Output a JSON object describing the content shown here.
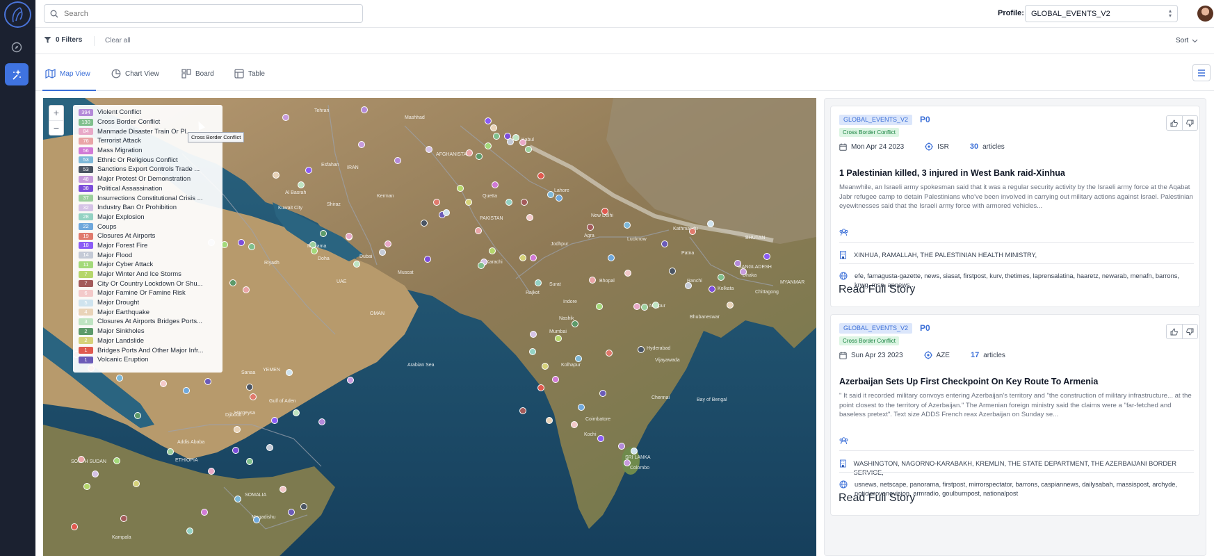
{
  "search": {
    "placeholder": "Search"
  },
  "profile": {
    "label": "Profile:",
    "value": "GLOBAL_EVENTS_V2"
  },
  "filterbar": {
    "filters_label": "0 Filters",
    "clear_label": "Clear all",
    "sort_label": "Sort"
  },
  "tabs": [
    {
      "label": "Map View",
      "active": true
    },
    {
      "label": "Chart View",
      "active": false
    },
    {
      "label": "Board",
      "active": false
    },
    {
      "label": "Table",
      "active": false
    }
  ],
  "legend": [
    {
      "count": "394",
      "label": "Violent Conflict",
      "color": "#b48ad9"
    },
    {
      "count": "130",
      "label": "Cross Border Conflict",
      "color": "#7fbf8c"
    },
    {
      "count": "84",
      "label": "Manmade Disaster Train Or Pl...",
      "color": "#e8a9c7"
    },
    {
      "count": "76",
      "label": "Terrorist Attack",
      "color": "#e9a4a6"
    },
    {
      "count": "56",
      "label": "Mass Migration",
      "color": "#d17ad6"
    },
    {
      "count": "53",
      "label": "Ethnic Or Religious Conflict",
      "color": "#7db8d8"
    },
    {
      "count": "53",
      "label": "Sanctions Export Controls Trade ...",
      "color": "#4b5563"
    },
    {
      "count": "48",
      "label": "Major Protest Or Demonstration",
      "color": "#c79bdc"
    },
    {
      "count": "38",
      "label": "Political Assassination",
      "color": "#7c4ddb"
    },
    {
      "count": "37",
      "label": "Insurrections Constitutional Crisis ...",
      "color": "#9ccf9d"
    },
    {
      "count": "32",
      "label": "Industry Ban Or Prohibition",
      "color": "#d5c3e6"
    },
    {
      "count": "28",
      "label": "Major Explosion",
      "color": "#94d2c3"
    },
    {
      "count": "22",
      "label": "Coups",
      "color": "#6fa8dc"
    },
    {
      "count": "19",
      "label": "Closures At Airports",
      "color": "#e07a6c"
    },
    {
      "count": "18",
      "label": "Major Forest Fire",
      "color": "#8b5cf6"
    },
    {
      "count": "14",
      "label": "Major Flood",
      "color": "#c4cad6"
    },
    {
      "count": "11",
      "label": "Major Cyber Attack",
      "color": "#a3d97a"
    },
    {
      "count": "7",
      "label": "Major Winter And Ice Storms",
      "color": "#b5d66b"
    },
    {
      "count": "7",
      "label": "City Or Country Lockdown Or Shu...",
      "color": "#a35a5a"
    },
    {
      "count": "6",
      "label": "Major Famine Or Famine Risk",
      "color": "#f3c9c9"
    },
    {
      "count": "5",
      "label": "Major Drought",
      "color": "#cfe3ee"
    },
    {
      "count": "4",
      "label": "Major Earthquake",
      "color": "#e9d3b8"
    },
    {
      "count": "3",
      "label": "Closures At Airports Bridges Ports...",
      "color": "#bfe4c2"
    },
    {
      "count": "2",
      "label": "Major Sinkholes",
      "color": "#5d9a6a"
    },
    {
      "count": "2",
      "label": "Major Landslide",
      "color": "#d6d27a"
    },
    {
      "count": "1",
      "label": "Bridges Ports And Other Major Infr...",
      "color": "#e05a4f"
    },
    {
      "count": "1",
      "label": "Volcanic Eruption",
      "color": "#6b5bb8"
    }
  ],
  "tooltip": "Cross Border Conflict",
  "map_labels": [
    "Tehran",
    "Mashhad",
    "Kabul",
    "AFGHANISTAN",
    "IRAN",
    "Esfahan",
    "Kerman",
    "Shiraz",
    "Quetta",
    "PAKISTAN",
    "New Delhi",
    "Agra",
    "Lucknow",
    "Kathmandu",
    "Patna",
    "Dhaka",
    "BANGLADESH",
    "Kolkata",
    "Chittagong",
    "Ranchi",
    "Bhopal",
    "Nagpur",
    "Hyderabad",
    "Mumbai",
    "Surat",
    "Rajkot",
    "Nashik",
    "Bhubaneswar",
    "Vijayawada",
    "Chennai",
    "Coimbatore",
    "Kochi",
    "Colombo",
    "SRI LANKA",
    "Arabian Sea",
    "Bay of Bengal",
    "Karachi",
    "Muscat",
    "OMAN",
    "UAE",
    "Dubai",
    "Doha",
    "Manama",
    "Riyadh",
    "Kuwait City",
    "Al Basrah",
    "YEMEN",
    "Djibouti",
    "Addis Ababa",
    "ETHIOPIA",
    "SOMALIA",
    "Mogadishu",
    "Kampala",
    "SOUTH SUDAN",
    "Jodhpur",
    "Lahore",
    "Indore",
    "Kolhapur",
    "Hargeysa",
    "Sanaa",
    "Gulf of Aden",
    "BHUTAN",
    "MYANMAR"
  ],
  "cards": [
    {
      "profile_tag": "GLOBAL_EVENTS_V2",
      "priority": "P0",
      "category": "Cross Border Conflict",
      "date": "Mon Apr 24 2023",
      "country": "ISR",
      "article_count": "30",
      "articles_label": "articles",
      "title": "1 Palestinian killed, 3 injured in West Bank raid-Xinhua",
      "body": "Meanwhile, an Israeli army spokesman said that it was a regular security activity by the Israeli army force at the Aqabat Jabr refugee camp to detain Palestinians who've been involved in carrying out military actions against Israel. Palestinian eyewitnesses said that the Israeli army force with armored vehicles...",
      "entities": "XINHUA, RAMALLAH, THE PALESTINIAN HEALTH MINISTRY,",
      "sources": "efe, famagusta-gazette, news, siasat, firstpost, kurv, thetimes, laprensalatina, haaretz, newarab, menafn, barrons, krwg, msn, apnews...",
      "button": "Read Full Story"
    },
    {
      "profile_tag": "GLOBAL_EVENTS_V2",
      "priority": "P0",
      "category": "Cross Border Conflict",
      "date": "Sun Apr 23 2023",
      "country": "AZE",
      "article_count": "17",
      "articles_label": "articles",
      "title": "Azerbaijan Sets Up First Checkpoint On Key Route To Armenia",
      "body": "\" It said it recorded military convoys entering Azerbaijan's territory and \"the construction of military infrastructure... at the point closest to the territory of Azerbaijan.\" The Armenian foreign ministry said the claims were a \"far-fetched and baseless pretext\". Text size ADDS French reax Azerbaijan on Sunday se...",
      "entities": "WASHINGTON, NAGORNO-KARABAKH, KREMLIN, THE STATE DEPARTMENT, THE AZERBAIJANI BORDER SERVICE,",
      "sources": "usnews, netscape, panorama, firstpost, mirrorspectator, barrons, caspiannews, dailysabah, massispost, archyde, noticierovenevision, armradio, goulburnpost, nationalpost",
      "button": "Read Full Story"
    }
  ]
}
